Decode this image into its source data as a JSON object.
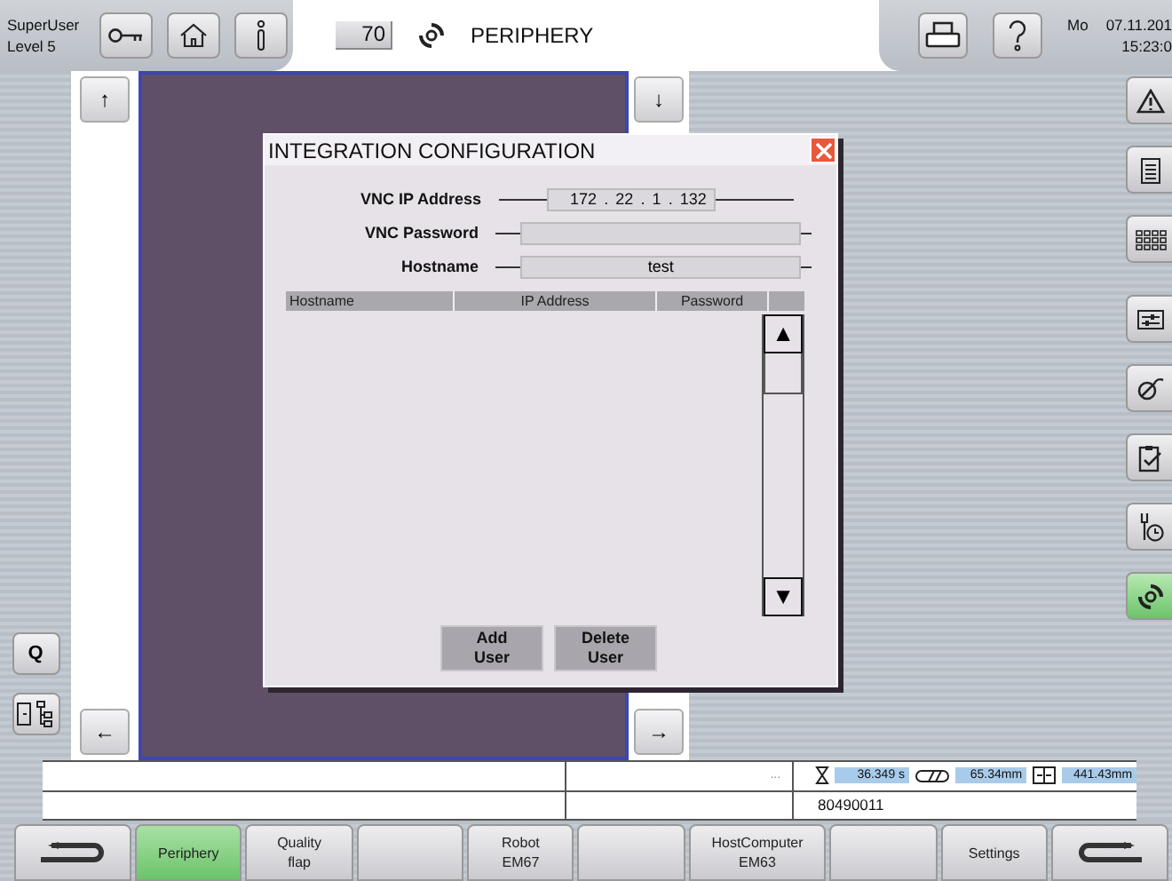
{
  "header": {
    "user": "SuperUser",
    "level": "Level 5",
    "number": "70",
    "title": "PERIPHERY",
    "day": "Mo",
    "date": "07.11.201",
    "time": "15:23:0"
  },
  "nav_arrows": {
    "up": "↑",
    "down": "↓",
    "left": "←",
    "right": "→"
  },
  "left_tools": [
    {
      "kind": "text",
      "label": "Q"
    },
    {
      "kind": "tree"
    }
  ],
  "right_tools": [
    {
      "kind": "warning",
      "selected": false
    },
    {
      "kind": "list",
      "selected": false
    },
    {
      "kind": "grid",
      "selected": false
    },
    {
      "kind": "sliders",
      "selected": false
    },
    {
      "kind": "tool",
      "selected": false
    },
    {
      "kind": "clipboard",
      "selected": false
    },
    {
      "kind": "service",
      "selected": false
    },
    {
      "kind": "cycle",
      "selected": true
    }
  ],
  "dialog": {
    "title": "INTEGRATION CONFIGURATION",
    "ip": {
      "label": "VNC IP Address",
      "parts": [
        "172",
        "22",
        "1",
        "132"
      ],
      "separator": "."
    },
    "fields": [
      {
        "label": "VNC Password"
      },
      {
        "label": "Hostname",
        "value": "test"
      }
    ],
    "table": {
      "columns": [
        "Hostname",
        "IP Address",
        "Password"
      ],
      "scroll_up": "▲",
      "scroll_down": "▼"
    },
    "buttons": [
      "Add User",
      "Delete User"
    ]
  },
  "status": {
    "row1_note": "...",
    "timer": "36.349 s",
    "distance": "65.34mm",
    "length": "441.43mm",
    "row2_value": "80490011"
  },
  "footer_buttons": [
    {
      "kind": "back",
      "selected": false
    },
    {
      "kind": "text",
      "label": "Periphery",
      "selected": true
    },
    {
      "kind": "text",
      "label": "Quality flap",
      "selected": false
    },
    {
      "kind": "blank",
      "selected": false
    },
    {
      "kind": "text",
      "label": "Robot EM67",
      "selected": false
    },
    {
      "kind": "blank",
      "selected": false
    },
    {
      "kind": "text",
      "label": "HostComputer EM63",
      "selected": false
    },
    {
      "kind": "blank",
      "selected": false
    },
    {
      "kind": "text",
      "label": "Settings",
      "selected": false
    },
    {
      "kind": "forward",
      "selected": false
    }
  ]
}
